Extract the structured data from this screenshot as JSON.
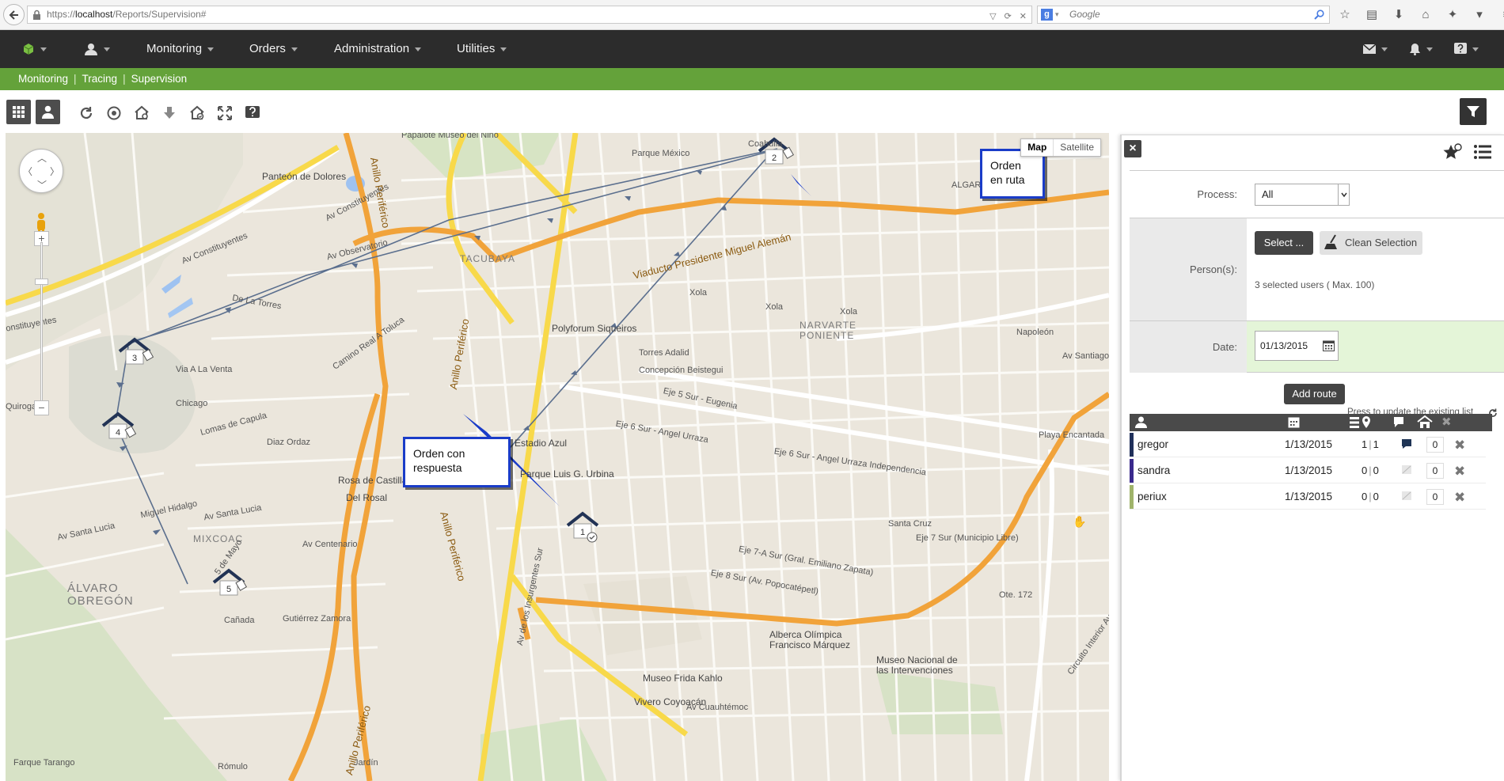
{
  "browser": {
    "url_prefix": "https://",
    "url_host": "localhost",
    "url_path": "/Reports/Supervision#",
    "search_engine": "g",
    "search_placeholder": "Google"
  },
  "nav": {
    "menu": [
      {
        "label": "Monitoring"
      },
      {
        "label": "Orders"
      },
      {
        "label": "Administration"
      },
      {
        "label": "Utilities"
      }
    ]
  },
  "breadcrumb": [
    "Monitoring",
    "Tracing",
    "Supervision"
  ],
  "map": {
    "type_map": "Map",
    "type_satellite": "Satellite",
    "callout_route": "Orden\nen ruta",
    "callout_response": "Orden con\nrespuesta",
    "markers": [
      "1",
      "2",
      "3",
      "4",
      "5"
    ],
    "labels": {
      "parque_mexico": "Parque México",
      "panteon": "Panteón de Dolores",
      "av_constituyentes": "Av Constituyentes",
      "av_constituyentes2": "Av Constituyentes",
      "constituyentes_edge": "onstituyentes",
      "av_observatorio": "Av Observatorio",
      "tacubaya": "TACUBAYA",
      "viaducto": "Viaducto Presidente Miguel Alemán",
      "polyforum": "Polyforum Siqueiros",
      "torres_adalid": "Torres Adalid",
      "concepcion": "Concepción Beistegui",
      "eje5": "Eje 5 Sur - Eugenia",
      "eje6": "Eje 6 Sur - Angel Urraza",
      "eje6b": "Eje 6 Sur - Angel Urraza Independencia",
      "estadio_azul": "Estadio Azul",
      "parque_luis": "Parque Luis G. Urbina",
      "chicago": "Chicago",
      "lomas_capula": "Lomas de Capula",
      "rosa_castilla": "Rosa de Castilla",
      "del_rosal": "Del Rosal",
      "mixcoac": "MIXCOAC",
      "av_centenario": "Av Centenario",
      "alvaro": "ÁLVARO\nOBREGÓN",
      "miguel_hidalgo": "Miguel Hidalgo",
      "av_santa_lucia": "Av Santa Lucia",
      "av_santa_lucia2": "Av Santa Lucia",
      "gutierrez": "Gutiérrez Zamora",
      "canada": "Cañada",
      "mayo": "5 de Mayo",
      "narvarte": "NARVARTE\nPONIENTE",
      "xola1": "Xola",
      "xola2": "Xola",
      "xola3": "Xola",
      "napoleon": "Napoleón",
      "av_santiago": "Av Santiago",
      "santa_cruz": "Santa Cruz",
      "eje7": "Eje 7 Sur (Municipio Libre)",
      "eje7a": "Eje 7-A Sur (Gral. Emiliano Zapata)",
      "eje8": "Eje 8 Sur (Av. Popocatépetl)",
      "ote172": "Ote. 172",
      "circuito": "Circuito Interior Avenida Río Churubusco",
      "albercaolimpica": "Alberca Olímpica\nFrancisco Márquez",
      "museo_nacional": "Museo Nacional de\nlas Intervenciones",
      "museo_frida": "Museo Frida Kahlo",
      "vivero": "Vivero Coyoacán",
      "anillo1": "Anillo Periférico",
      "anillo2": "Anillo Periférico",
      "anillo3": "Anillo Periférico",
      "anillo4": "Anillo Periférico",
      "insurgentes": "Av de los Insurgentes Sur",
      "de_la_torres": "De La Torres",
      "camino_real": "Camino Real A Toluca",
      "via_la_venta": "Via A La Venta",
      "diaz_ordaz": "Diaz Ordaz",
      "coahuila": "Coahuila",
      "algar": "ALGAR",
      "playa_encantada": "Playa Encantada",
      "farque_tarango": "Farque Tarango",
      "romulo": "Rómulo",
      "jardin": "Jardín",
      "av_cuauhtemoc": "Av Cuauhtémoc",
      "quiroga": "Quiroga",
      "dolores": "Papalote Museo del Niño"
    }
  },
  "panel": {
    "process_label": "Process:",
    "process_value": "All",
    "persons_label": "Person(s):",
    "select_btn": "Select ...",
    "clean_btn": "Clean Selection",
    "selected_info": "3 selected users ( Max. 100)",
    "date_label": "Date:",
    "date_value": "01/13/2015",
    "add_route_btn": "Add route",
    "update_hint": "Press to update the existing list",
    "rows": [
      {
        "name": "gregor",
        "date": "1/13/2015",
        "a": "1",
        "b": "1",
        "count": "0",
        "color": "#1f2f5a",
        "msg_active": true
      },
      {
        "name": "sandra",
        "date": "1/13/2015",
        "a": "0",
        "b": "0",
        "count": "0",
        "color": "#3a2a8c",
        "msg_active": false
      },
      {
        "name": "periux",
        "date": "1/13/2015",
        "a": "0",
        "b": "0",
        "count": "0",
        "color": "#9fb36a",
        "msg_active": false
      }
    ]
  }
}
